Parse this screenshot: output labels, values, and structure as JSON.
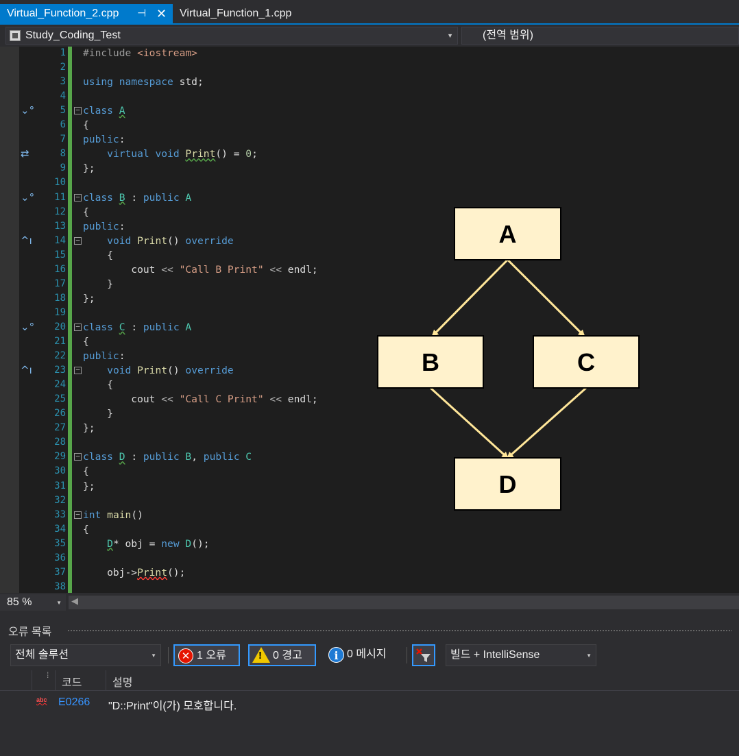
{
  "tabs": [
    {
      "label": "Virtual_Function_2.cpp",
      "active": true
    },
    {
      "label": "Virtual_Function_1.cpp",
      "active": false
    }
  ],
  "navbar": {
    "project": "Study_Coding_Test",
    "scope": "(전역 범위)"
  },
  "editor": {
    "lines": [
      {
        "n": "1",
        "html": "<span class=\"pp\">#include</span> <span class=\"inc\">&lt;iostream&gt;</span>"
      },
      {
        "n": "2",
        "html": ""
      },
      {
        "n": "3",
        "html": "<span class=\"kw\">using</span> <span class=\"kw\">namespace</span> std;"
      },
      {
        "n": "4",
        "html": ""
      },
      {
        "n": "5",
        "html": "<span class=\"kw\">class</span> <span class=\"cls sq-green\">A</span>",
        "fold": true,
        "glyph": "⌄°"
      },
      {
        "n": "6",
        "html": "{"
      },
      {
        "n": "7",
        "html": "<span class=\"kw\">public</span>:"
      },
      {
        "n": "8",
        "html": "    <span class=\"kw\">virtual</span> <span class=\"kw\">void</span> <span class=\"fn sq-green\">Print</span>() = <span style=\"color:#b5cea8\">0</span>;",
        "glyph": "⇄"
      },
      {
        "n": "9",
        "html": "};"
      },
      {
        "n": "10",
        "html": ""
      },
      {
        "n": "11",
        "html": "<span class=\"kw\">class</span> <span class=\"cls sq-green\">B</span> : <span class=\"kw\">public</span> <span class=\"cls\">A</span>",
        "fold": true,
        "glyph": "⌄°"
      },
      {
        "n": "12",
        "html": "{"
      },
      {
        "n": "13",
        "html": "<span class=\"kw\">public</span>:"
      },
      {
        "n": "14",
        "html": "    <span class=\"kw\">void</span> <span class=\"fn\">Print</span>() <span class=\"kw\">override</span>",
        "fold": true,
        "glyph": "^ı"
      },
      {
        "n": "15",
        "html": "    {"
      },
      {
        "n": "16",
        "html": "        cout <span class=\"op\">&lt;&lt;</span> <span class=\"str\">\"Call B Print\"</span> <span class=\"op\">&lt;&lt;</span> endl;"
      },
      {
        "n": "17",
        "html": "    }"
      },
      {
        "n": "18",
        "html": "};"
      },
      {
        "n": "19",
        "html": ""
      },
      {
        "n": "20",
        "html": "<span class=\"kw\">class</span> <span class=\"cls sq-green\">C</span> : <span class=\"kw\">public</span> <span class=\"cls\">A</span>",
        "fold": true,
        "glyph": "⌄°"
      },
      {
        "n": "21",
        "html": "{"
      },
      {
        "n": "22",
        "html": "<span class=\"kw\">public</span>:"
      },
      {
        "n": "23",
        "html": "    <span class=\"kw\">void</span> <span class=\"fn\">Print</span>() <span class=\"kw\">override</span>",
        "fold": true,
        "glyph": "^ı"
      },
      {
        "n": "24",
        "html": "    {"
      },
      {
        "n": "25",
        "html": "        cout <span class=\"op\">&lt;&lt;</span> <span class=\"str\">\"Call C Print\"</span> <span class=\"op\">&lt;&lt;</span> endl;"
      },
      {
        "n": "26",
        "html": "    }"
      },
      {
        "n": "27",
        "html": "};"
      },
      {
        "n": "28",
        "html": ""
      },
      {
        "n": "29",
        "html": "<span class=\"kw\">class</span> <span class=\"cls sq-green\">D</span> : <span class=\"kw\">public</span> <span class=\"cls\">B</span>, <span class=\"kw\">public</span> <span class=\"cls\">C</span>",
        "fold": true
      },
      {
        "n": "30",
        "html": "{"
      },
      {
        "n": "31",
        "html": "};"
      },
      {
        "n": "32",
        "html": ""
      },
      {
        "n": "33",
        "html": "<span class=\"kw\">int</span> <span class=\"fn\">main</span>()",
        "fold": true
      },
      {
        "n": "34",
        "html": "{"
      },
      {
        "n": "35",
        "html": "    <span class=\"cls sq-green\">D</span>* obj = <span class=\"kw\">new</span> <span class=\"cls\">D</span>();"
      },
      {
        "n": "36",
        "html": ""
      },
      {
        "n": "37",
        "html": "    obj-&gt;<span class=\"fn sq-red\">Print</span>();"
      },
      {
        "n": "38",
        "html": ""
      }
    ]
  },
  "diagram": {
    "nodes": [
      {
        "id": "A",
        "label": "A"
      },
      {
        "id": "B",
        "label": "B"
      },
      {
        "id": "C",
        "label": "C"
      },
      {
        "id": "D",
        "label": "D"
      }
    ],
    "edges": [
      [
        "A",
        "B"
      ],
      [
        "A",
        "C"
      ],
      [
        "B",
        "D"
      ],
      [
        "C",
        "D"
      ]
    ],
    "colors": {
      "box_fill": "#fff2cc",
      "box_stroke": "#000000",
      "arrow": "#ffe699"
    }
  },
  "zoom": "85 %",
  "error_list": {
    "title": "오류 목록",
    "scope": "전체 솔루션",
    "errors_btn": "1 오류",
    "warnings_btn": "0 경고",
    "messages_btn": "0 메시지",
    "source": "빌드 + IntelliSense",
    "col_code": "코드",
    "col_desc": "설명",
    "rows": [
      {
        "code": "E0266",
        "desc": "\"D::Print\"이(가) 모호합니다."
      }
    ]
  },
  "icons": {
    "close": "close-icon",
    "pin": "pin-icon",
    "project": "project-icon",
    "error": "error-icon",
    "warning": "warning-icon",
    "info": "info-icon",
    "filter": "filter-icon"
  }
}
